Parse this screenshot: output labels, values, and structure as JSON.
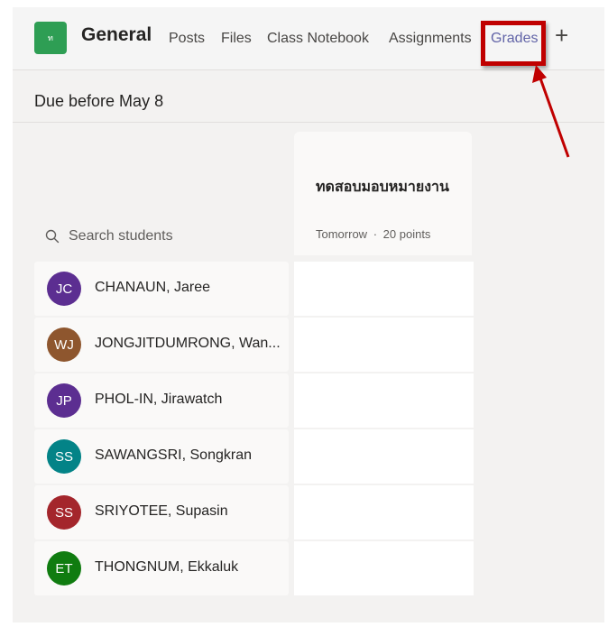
{
  "header": {
    "team_icon_text": "ท",
    "channel_name": "General",
    "tabs": [
      {
        "label": "Posts"
      },
      {
        "label": "Files"
      },
      {
        "label": "Class Notebook"
      },
      {
        "label": "Assignments"
      },
      {
        "label": "Grades",
        "active": true
      }
    ],
    "add_tab_glyph": "+"
  },
  "due_label": "Due before May 8",
  "search": {
    "placeholder": "Search students",
    "icon": "search-icon"
  },
  "assignment": {
    "title": "ทดสอบมอบหมายงาน",
    "due": "Tomorrow",
    "separator": "·",
    "points": "20 points"
  },
  "students": [
    {
      "initials": "JC",
      "name": "CHANAUN, Jaree",
      "color": "#5c2e91"
    },
    {
      "initials": "WJ",
      "name": "JONGJITDUMRONG, Wan...",
      "color": "#8e562e"
    },
    {
      "initials": "JP",
      "name": "PHOL-IN, Jirawatch",
      "color": "#5c2e91"
    },
    {
      "initials": "SS",
      "name": "SAWANGSRI, Songkran",
      "color": "#038387"
    },
    {
      "initials": "SS",
      "name": "SRIYOTEE, Supasin",
      "color": "#a4262c"
    },
    {
      "initials": "ET",
      "name": "THONGNUM, Ekkaluk",
      "color": "#107c10"
    }
  ],
  "colors": {
    "accent": "#6264a7",
    "highlight": "#c00000"
  }
}
